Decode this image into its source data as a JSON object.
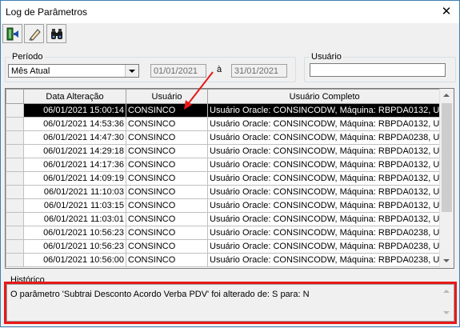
{
  "window": {
    "title": "Log de Parâmetros",
    "close": "✕"
  },
  "toolbar": {
    "buttons": [
      "exit-icon",
      "eraser-icon",
      "binoculars-icon"
    ]
  },
  "periodo": {
    "label": "Período",
    "selected": "Mês Atual",
    "date_from": "01/01/2021",
    "separator": "à",
    "date_to": "31/01/2021"
  },
  "usuario_filter": {
    "label": "Usuário",
    "value": ""
  },
  "grid": {
    "columns": [
      "Data Alteração",
      "Usuário",
      "Usuário Completo"
    ],
    "selected_row": 0,
    "rows": [
      {
        "date": "06/01/2021 15:00:14",
        "user": "CONSINCO",
        "full": "Usuário Oracle: CONSINCODW, Máquina: RBPDA0132, U"
      },
      {
        "date": "06/01/2021 14:53:36",
        "user": "CONSINCO",
        "full": "Usuário Oracle: CONSINCODW, Máquina: RBPDA0132, U"
      },
      {
        "date": "06/01/2021 14:47:30",
        "user": "CONSINCO",
        "full": "Usuário Oracle: CONSINCODW, Máquina: RBPDA0238, U"
      },
      {
        "date": "06/01/2021 14:29:18",
        "user": "CONSINCO",
        "full": "Usuário Oracle: CONSINCODW, Máquina: RBPDA0132, U"
      },
      {
        "date": "06/01/2021 14:17:36",
        "user": "CONSINCO",
        "full": "Usuário Oracle: CONSINCODW, Máquina: RBPDA0132, U"
      },
      {
        "date": "06/01/2021 14:09:19",
        "user": "CONSINCO",
        "full": "Usuário Oracle: CONSINCODW, Máquina: RBPDA0132, U"
      },
      {
        "date": "06/01/2021 11:10:03",
        "user": "CONSINCO",
        "full": "Usuário Oracle: CONSINCODW, Máquina: RBPDA0132, U"
      },
      {
        "date": "06/01/2021 11:03:15",
        "user": "CONSINCO",
        "full": "Usuário Oracle: CONSINCODW, Máquina: RBPDA0132, U"
      },
      {
        "date": "06/01/2021 11:03:01",
        "user": "CONSINCO",
        "full": "Usuário Oracle: CONSINCODW, Máquina: RBPDA0132, U"
      },
      {
        "date": "06/01/2021 10:56:23",
        "user": "CONSINCO",
        "full": "Usuário Oracle: CONSINCODW, Máquina: RBPDA0238, U"
      },
      {
        "date": "06/01/2021 10:56:23",
        "user": "CONSINCO",
        "full": "Usuário Oracle: CONSINCODW, Máquina: RBPDA0238, U"
      },
      {
        "date": "06/01/2021 10:56:00",
        "user": "CONSINCO",
        "full": "Usuário Oracle: CONSINCODW, Máquina: RBPDA0238, U"
      }
    ]
  },
  "historico": {
    "label": "Histórico",
    "text": "O parâmetro 'Subtrai Desconto Acordo Verba PDV' foi alterado de: S para: N"
  },
  "colors": {
    "highlight": "#e81818",
    "selected_row_bg": "#000000",
    "arrow": "#e81818"
  }
}
